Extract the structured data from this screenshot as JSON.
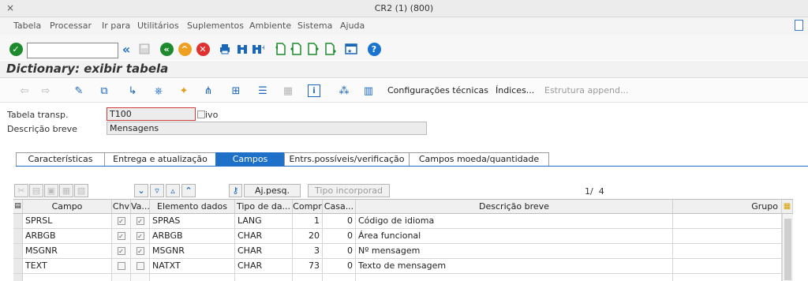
{
  "window": {
    "title": "CR2 (1) (800)",
    "close_glyph": "×"
  },
  "menu": [
    "Tabela",
    "Processar",
    "Ir para",
    "Utilitários",
    "Suplementos",
    "Ambiente",
    "Sistema",
    "Ajuda"
  ],
  "toolbar": {
    "command_value": "",
    "expand_glyph": "«"
  },
  "page": {
    "title": "Dictionary: exibir tabela"
  },
  "app_toolbar": {
    "technical_settings": "Configurações técnicas",
    "indexes": "Índices...",
    "append_structure": "Estrutura append..."
  },
  "header_fields": {
    "table_label": "Tabela transp.",
    "table_value": "T100",
    "status_fragment": "ivo",
    "desc_label": "Descrição breve",
    "desc_value": "Mensagens"
  },
  "tabs": [
    "Características",
    "Entrega e atualização",
    "Campos",
    "Entrs.possíveis/verificação",
    "Campos moeda/quantidade"
  ],
  "active_tab": 2,
  "grid_toolbar": {
    "search_help": "Aj.pesq.",
    "builtin_type": "Tipo incorporad",
    "page_info": "1/  4"
  },
  "table": {
    "columns": [
      "Campo",
      "Chv",
      "Va...",
      "Elemento dados",
      "Tipo de da...",
      "Compr",
      "Casa...",
      "Descrição breve",
      "Grupo"
    ],
    "rows": [
      {
        "campo": "SPRSL",
        "chv": true,
        "va": true,
        "elemento": "SPRAS",
        "tipo": "LANG",
        "compr": "1",
        "casas": "0",
        "descricao": "Código de idioma",
        "grupo": ""
      },
      {
        "campo": "ARBGB",
        "chv": true,
        "va": true,
        "elemento": "ARBGB",
        "tipo": "CHAR",
        "compr": "20",
        "casas": "0",
        "descricao": "Área funcional",
        "grupo": ""
      },
      {
        "campo": "MSGNR",
        "chv": true,
        "va": true,
        "elemento": "MSGNR",
        "tipo": "CHAR",
        "compr": "3",
        "casas": "0",
        "descricao": "Nº mensagem",
        "grupo": ""
      },
      {
        "campo": "TEXT",
        "chv": false,
        "va": false,
        "elemento": "NATXT",
        "tipo": "CHAR",
        "compr": "73",
        "casas": "0",
        "descricao": "Texto de mensagem",
        "grupo": ""
      }
    ]
  },
  "colors": {
    "accent": "#1f70c8",
    "ok_green": "#1e8a2e",
    "warn_orange": "#f0a020",
    "cancel_red": "#e03030",
    "help_blue": "#1a73d0"
  }
}
